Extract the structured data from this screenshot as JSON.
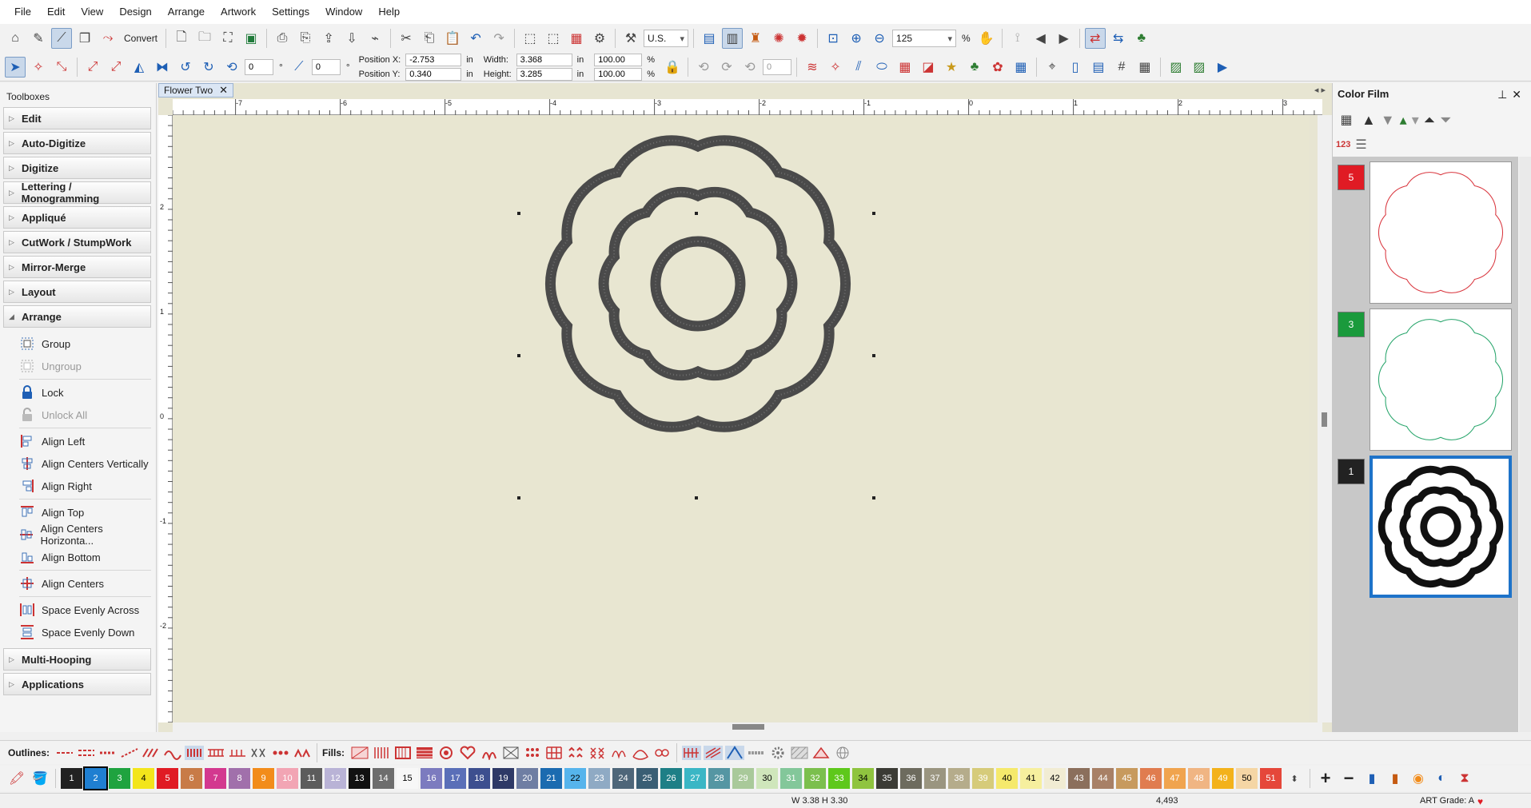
{
  "menubar": [
    "File",
    "Edit",
    "View",
    "Design",
    "Arrange",
    "Artwork",
    "Settings",
    "Window",
    "Help"
  ],
  "toolbar1": {
    "convert_label": "Convert",
    "units": "U.S.",
    "zoom": "125",
    "zoom_unit": "%"
  },
  "toolbar2": {
    "rotate_value": "0",
    "slant_value": "0",
    "pos_x_label": "Position X:",
    "pos_x": "-2.753",
    "pos_y_label": "Position Y:",
    "pos_y": "0.340",
    "width_label": "Width:",
    "width": "3.368",
    "height_label": "Height:",
    "height": "3.285",
    "unit": "in",
    "scale_w": "100.00",
    "scale_h": "100.00",
    "pct": "%",
    "angle_value": "0"
  },
  "toolboxes": {
    "title": "Toolboxes",
    "groups_top": [
      "Edit",
      "Auto-Digitize",
      "Digitize",
      "Lettering / Monogramming",
      "Appliqué",
      "CutWork / StumpWork",
      "Mirror-Merge",
      "Layout"
    ],
    "arrange_label": "Arrange",
    "arrange_items": [
      {
        "label": "Group",
        "disabled": false
      },
      {
        "label": "Ungroup",
        "disabled": true
      },
      {
        "label": "Lock",
        "disabled": false
      },
      {
        "label": "Unlock All",
        "disabled": true
      },
      {
        "label": "Align Left",
        "disabled": false
      },
      {
        "label": "Align Centers Vertically",
        "disabled": false
      },
      {
        "label": "Align Right",
        "disabled": false
      },
      {
        "label": "Align Top",
        "disabled": false
      },
      {
        "label": "Align Centers Horizonta...",
        "disabled": false
      },
      {
        "label": "Align Bottom",
        "disabled": false
      },
      {
        "label": "Align Centers",
        "disabled": false
      },
      {
        "label": "Space Evenly Across",
        "disabled": false
      },
      {
        "label": "Space Evenly Down",
        "disabled": false
      }
    ],
    "groups_bottom": [
      "Multi-Hooping",
      "Applications"
    ]
  },
  "document": {
    "tab_title": "Flower Two",
    "ruler_h": [
      "-7",
      "-6",
      "-5",
      "-4",
      "-3",
      "-2",
      "-1",
      "0",
      "1",
      "2",
      "3"
    ],
    "ruler_v": [
      "2",
      "1",
      "0",
      "-1",
      "-2"
    ]
  },
  "color_film": {
    "title": "Color Film",
    "sort_label": "123",
    "entries": [
      {
        "number": "5",
        "color": "#e01b24",
        "thread": "#d9363e"
      },
      {
        "number": "3",
        "color": "#1a9a3c",
        "thread": "#27a56b"
      },
      {
        "number": "1",
        "color": "#222222",
        "thread": "#111111"
      }
    ]
  },
  "stitch_bar": {
    "outlines_label": "Outlines:",
    "fills_label": "Fills:"
  },
  "palette": [
    {
      "n": "1",
      "c": "#222222",
      "t": "#fff"
    },
    {
      "n": "2",
      "c": "#1f7fd1",
      "t": "#fff"
    },
    {
      "n": "3",
      "c": "#1fa33f",
      "t": "#fff"
    },
    {
      "n": "4",
      "c": "#f3e51b",
      "t": "#000"
    },
    {
      "n": "5",
      "c": "#e01b24",
      "t": "#fff"
    },
    {
      "n": "6",
      "c": "#c87b47",
      "t": "#fff"
    },
    {
      "n": "7",
      "c": "#d3388f",
      "t": "#fff"
    },
    {
      "n": "8",
      "c": "#a170ab",
      "t": "#fff"
    },
    {
      "n": "9",
      "c": "#f28c1a",
      "t": "#fff"
    },
    {
      "n": "10",
      "c": "#f2a5b4",
      "t": "#fff"
    },
    {
      "n": "11",
      "c": "#5c5c5c",
      "t": "#fff"
    },
    {
      "n": "12",
      "c": "#b9b3d6",
      "t": "#fff"
    },
    {
      "n": "13",
      "c": "#111111",
      "t": "#fff"
    },
    {
      "n": "14",
      "c": "#6d6d6d",
      "t": "#fff"
    },
    {
      "n": "15",
      "c": "#f7f7f7",
      "t": "#000"
    },
    {
      "n": "16",
      "c": "#7c7bbf",
      "t": "#fff"
    },
    {
      "n": "17",
      "c": "#5a6fb8",
      "t": "#fff"
    },
    {
      "n": "18",
      "c": "#3d4f8f",
      "t": "#fff"
    },
    {
      "n": "19",
      "c": "#2e3966",
      "t": "#fff"
    },
    {
      "n": "20",
      "c": "#6f7ea3",
      "t": "#fff"
    },
    {
      "n": "21",
      "c": "#1b6bb0",
      "t": "#fff"
    },
    {
      "n": "22",
      "c": "#56b4ec",
      "t": "#000"
    },
    {
      "n": "23",
      "c": "#8faac4",
      "t": "#fff"
    },
    {
      "n": "24",
      "c": "#4e6679",
      "t": "#fff"
    },
    {
      "n": "25",
      "c": "#3a5e74",
      "t": "#fff"
    },
    {
      "n": "26",
      "c": "#1e7f86",
      "t": "#fff"
    },
    {
      "n": "27",
      "c": "#3ab6c5",
      "t": "#fff"
    },
    {
      "n": "28",
      "c": "#5596a3",
      "t": "#fff"
    },
    {
      "n": "29",
      "c": "#a9c99a",
      "t": "#fff"
    },
    {
      "n": "30",
      "c": "#cfe6bb",
      "t": "#000"
    },
    {
      "n": "31",
      "c": "#83c79a",
      "t": "#fff"
    },
    {
      "n": "32",
      "c": "#7bbf4d",
      "t": "#fff"
    },
    {
      "n": "33",
      "c": "#5ec81b",
      "t": "#fff"
    },
    {
      "n": "34",
      "c": "#8fc43f",
      "t": "#000"
    },
    {
      "n": "35",
      "c": "#3b3b35",
      "t": "#fff"
    },
    {
      "n": "36",
      "c": "#6d6b5e",
      "t": "#fff"
    },
    {
      "n": "37",
      "c": "#9a9580",
      "t": "#fff"
    },
    {
      "n": "38",
      "c": "#b5ac8b",
      "t": "#fff"
    },
    {
      "n": "39",
      "c": "#d6cb7a",
      "t": "#fff"
    },
    {
      "n": "40",
      "c": "#f5e96c",
      "t": "#000"
    },
    {
      "n": "41",
      "c": "#f6ef9e",
      "t": "#000"
    },
    {
      "n": "42",
      "c": "#f1ecd3",
      "t": "#000"
    },
    {
      "n": "43",
      "c": "#8b6f5c",
      "t": "#fff"
    },
    {
      "n": "44",
      "c": "#a88066",
      "t": "#fff"
    },
    {
      "n": "45",
      "c": "#c79a5e",
      "t": "#fff"
    },
    {
      "n": "46",
      "c": "#e07c4f",
      "t": "#fff"
    },
    {
      "n": "47",
      "c": "#f0a44e",
      "t": "#fff"
    },
    {
      "n": "48",
      "c": "#f0b583",
      "t": "#fff"
    },
    {
      "n": "49",
      "c": "#f3b21b",
      "t": "#fff"
    },
    {
      "n": "50",
      "c": "#f5d6a5",
      "t": "#000"
    },
    {
      "n": "51",
      "c": "#e5473a",
      "t": "#fff"
    }
  ],
  "status": {
    "dimensions": "W 3.38 H 3.30",
    "stitch_count": "4,493",
    "art_grade": "ART Grade: A"
  },
  "colors": {
    "canvas": "#e8e6d1",
    "selection_blue": "#1e73c9",
    "stitch_dark": "#4a4a4a"
  }
}
